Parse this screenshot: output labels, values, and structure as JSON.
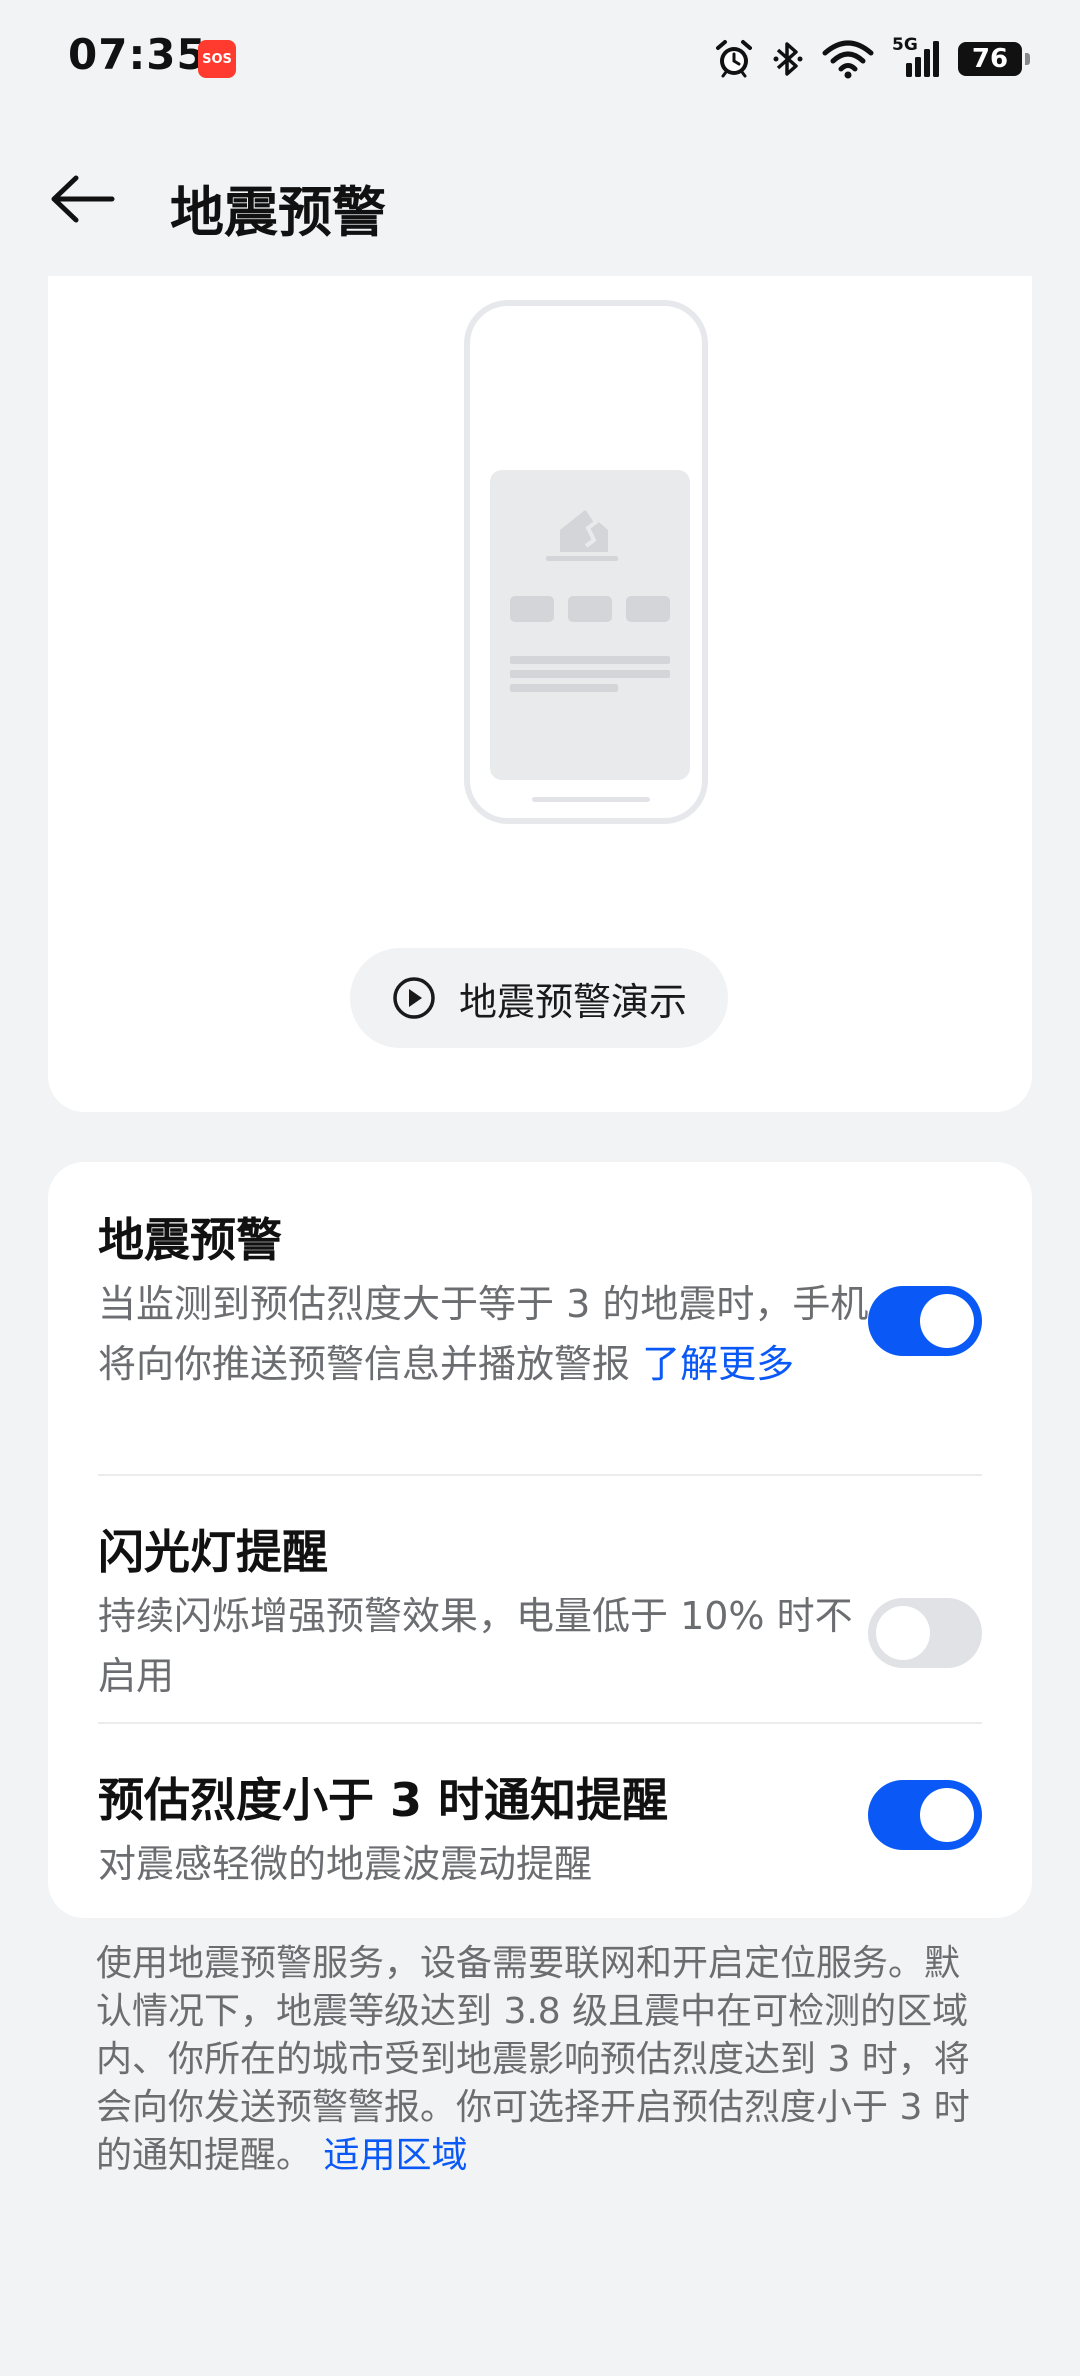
{
  "status_bar": {
    "time": "07:35",
    "sos_badge": "SOS",
    "network": "5G",
    "battery": "76"
  },
  "header": {
    "title": "地震预警"
  },
  "demo": {
    "button_label": "地震预警演示"
  },
  "settings": [
    {
      "title": "地震预警",
      "description": "当监测到预估烈度大于等于 3 的地震时，手机将向你推送预警信息并播放警报",
      "link": "了解更多",
      "enabled": true
    },
    {
      "title": "闪光灯提醒",
      "description": "持续闪烁增强预警效果，电量低于 10% 时不启用",
      "enabled": false
    },
    {
      "title": "预估烈度小于 3 时通知提醒",
      "description": "对震感轻微的地震波震动提醒",
      "enabled": true
    }
  ],
  "footer": {
    "text": "使用地震预警服务，设备需要联网和开启定位服务。默认情况下，地震等级达到 3.8 级且震中在可检测的区域内、你所在的城市受到地震影响预估烈度达到 3 时，将会向你发送预警警报。你可选择开启预估烈度小于 3 时的通知提醒。",
    "link": "适用区域"
  },
  "colors": {
    "accent": "#0a59f7",
    "background": "#f1f3f5",
    "toggle_off": "#e1e2e5"
  }
}
